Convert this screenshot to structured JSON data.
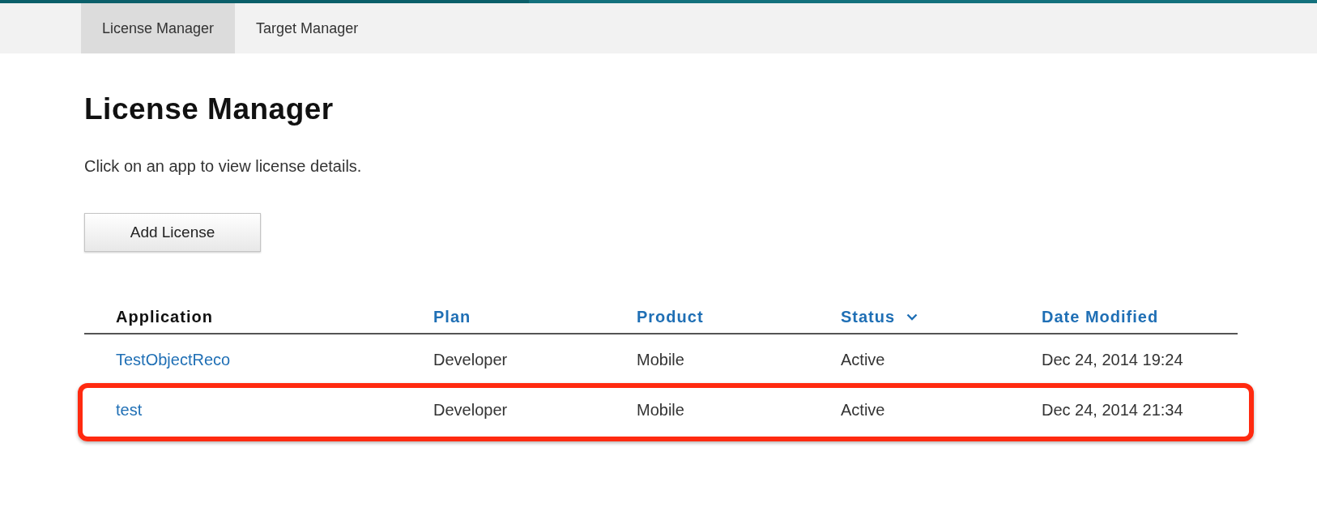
{
  "tabs": [
    {
      "label": "License Manager",
      "selected": true
    },
    {
      "label": "Target Manager",
      "selected": false
    }
  ],
  "heading": "License Manager",
  "intro": "Click on an app to view license details.",
  "add_button": "Add License",
  "table": {
    "columns": [
      {
        "label": "Application",
        "sortable": false,
        "sorted": false
      },
      {
        "label": "Plan",
        "sortable": true,
        "sorted": false
      },
      {
        "label": "Product",
        "sortable": true,
        "sorted": false
      },
      {
        "label": "Status",
        "sortable": true,
        "sorted": true
      },
      {
        "label": "Date Modified",
        "sortable": true,
        "sorted": false
      }
    ],
    "rows": [
      {
        "cells": [
          "TestObjectReco",
          "Developer",
          "Mobile",
          "Active",
          "Dec 24, 2014 19:24"
        ],
        "highlighted": false
      },
      {
        "cells": [
          "test",
          "Developer",
          "Mobile",
          "Active",
          "Dec 24, 2014 21:34"
        ],
        "highlighted": true
      }
    ]
  }
}
